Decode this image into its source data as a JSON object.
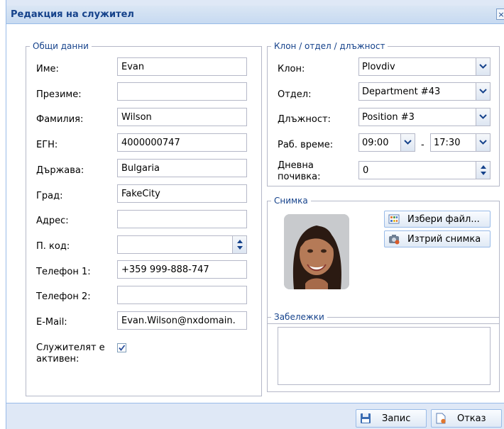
{
  "dialog": {
    "title": "Редакция на служител",
    "close_glyph": "×"
  },
  "general": {
    "legend": "Общи данни",
    "fields": {
      "name": {
        "label": "Име:",
        "value": "Evan"
      },
      "middle_name": {
        "label": "Презиме:",
        "value": ""
      },
      "last_name": {
        "label": "Фамилия:",
        "value": "Wilson"
      },
      "egn": {
        "label": "ЕГН:",
        "value": "4000000747"
      },
      "country": {
        "label": "Държава:",
        "value": "Bulgaria"
      },
      "city": {
        "label": "Град:",
        "value": "FakeCity"
      },
      "address": {
        "label": "Адрес:",
        "value": ""
      },
      "postal_code": {
        "label": "П. код:",
        "value": ""
      },
      "phone1": {
        "label": "Телефон 1:",
        "value": "+359 999-888-747"
      },
      "phone2": {
        "label": "Телефон 2:",
        "value": ""
      },
      "email": {
        "label": "E-Mail:",
        "value": "Evan.Wilson@nxdomain."
      }
    },
    "active": {
      "label_line1": "Служителят е",
      "label_line2": "активен:",
      "checked": true
    }
  },
  "branch": {
    "legend": "Клон / отдел / длъжност",
    "branch": {
      "label": "Клон:",
      "value": "Plovdiv"
    },
    "department": {
      "label": "Отдел:",
      "value": "Department #43"
    },
    "position": {
      "label": "Длъжност:",
      "value": "Position #3"
    },
    "work_time": {
      "label": "Раб. време:",
      "from": "09:00",
      "separator": "-",
      "to": "17:30"
    },
    "daily_break": {
      "label_line1": "Дневна",
      "label_line2": "почивка:",
      "value": "0"
    }
  },
  "photo": {
    "legend": "Снимка",
    "choose_file_label": "Избери файл...",
    "delete_photo_label": "Изтрий снимка"
  },
  "notes": {
    "legend": "Забележки",
    "value": ""
  },
  "footer": {
    "save_label": "Запис",
    "cancel_label": "Отказ"
  },
  "colors": {
    "accent": "#15428b",
    "window_bg": "#dfe8f6",
    "border": "#b5b8c8"
  },
  "icons": {
    "combo_trigger": "chevron-down-icon",
    "spinner": "spinner-arrows-icon",
    "choose_file": "grid-file-icon",
    "delete_photo": "camera-delete-icon",
    "save": "floppy-disk-icon",
    "cancel": "document-cancel-icon"
  }
}
